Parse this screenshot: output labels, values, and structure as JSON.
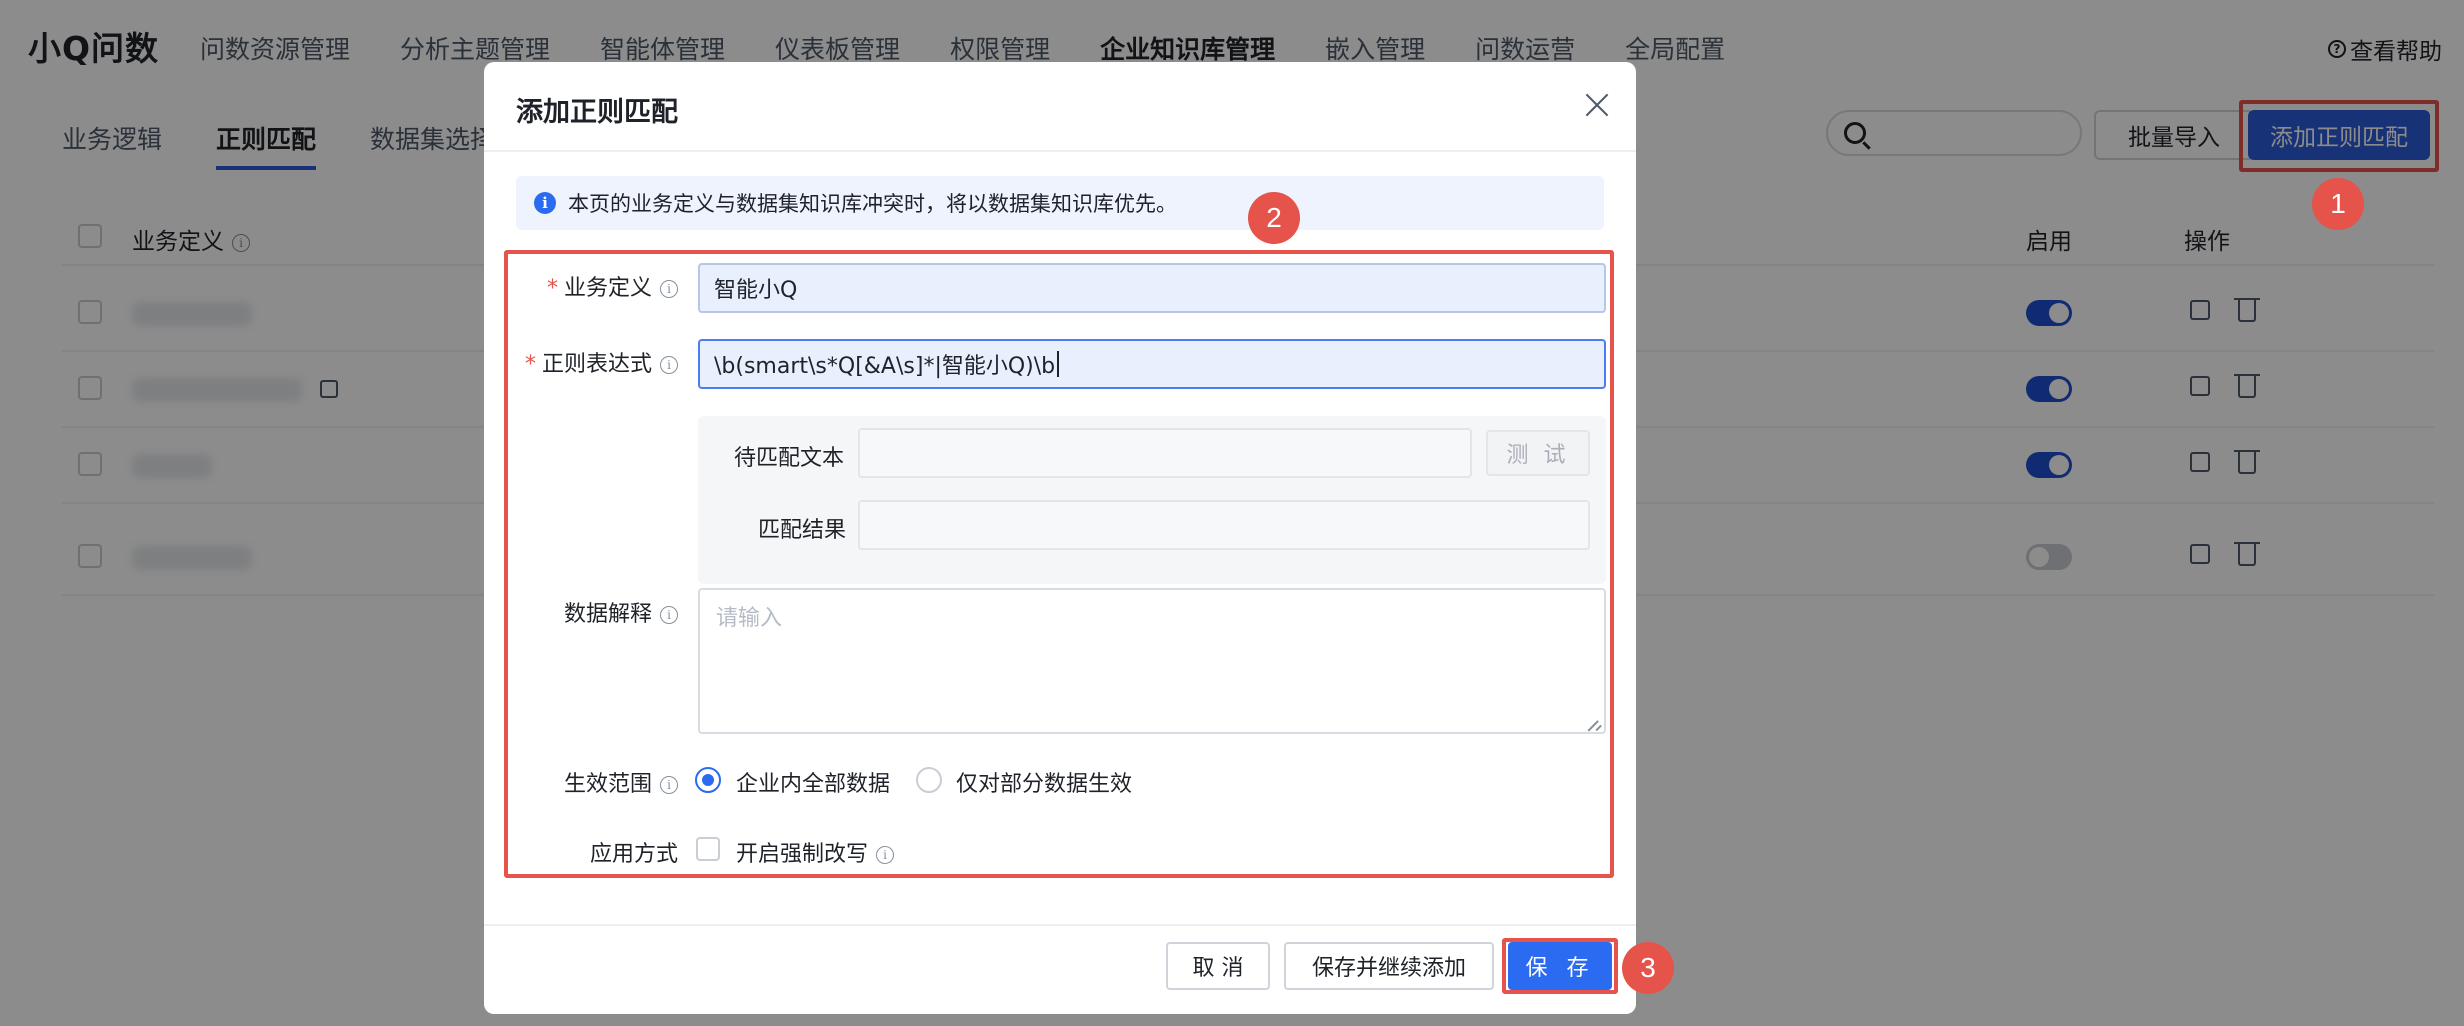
{
  "app": {
    "brand": "小Q问数",
    "nav": [
      "问数资源管理",
      "分析主题管理",
      "智能体管理",
      "仪表板管理",
      "权限管理",
      "企业知识库管理",
      "嵌入管理",
      "问数运营",
      "全局配置"
    ],
    "help": "查看帮助"
  },
  "page": {
    "subtabs": [
      "业务逻辑",
      "正则匹配",
      "数据集选择"
    ],
    "import_button": "批量导入",
    "add_button": "添加正则匹配",
    "columns": {
      "definition": "业务定义",
      "enabled": "启用",
      "actions": "操作"
    },
    "rows": [
      {
        "enabled": true
      },
      {
        "enabled": true
      },
      {
        "enabled": true
      },
      {
        "enabled": false
      }
    ]
  },
  "modal": {
    "title": "添加正则匹配",
    "info": "本页的业务定义与数据集知识库冲突时，将以数据集知识库优先。",
    "fields": {
      "definition_label": "业务定义",
      "definition_value": "智能小Q",
      "regex_label": "正则表达式",
      "regex_value": "\\b(smart\\s*Q[&A\\s]*|智能小Q)\\b",
      "test_text_label": "待匹配文本",
      "test_button": "测 试",
      "result_label": "匹配结果",
      "explain_label": "数据解释",
      "explain_placeholder": "请输入",
      "scope_label": "生效范围",
      "scope_options": [
        "企业内全部数据",
        "仅对部分数据生效"
      ],
      "scope_selected": "企业内全部数据",
      "apply_label": "应用方式",
      "apply_checkbox": "开启强制改写"
    },
    "footer": {
      "cancel": "取 消",
      "save_continue": "保存并继续添加",
      "save": "保 存"
    }
  },
  "annotations": {
    "step1": "1",
    "step2": "2",
    "step3": "3"
  },
  "colors": {
    "primary": "#2b6bf2",
    "highlight": "#e5534b",
    "nav_accent": "#2b5bd7"
  }
}
